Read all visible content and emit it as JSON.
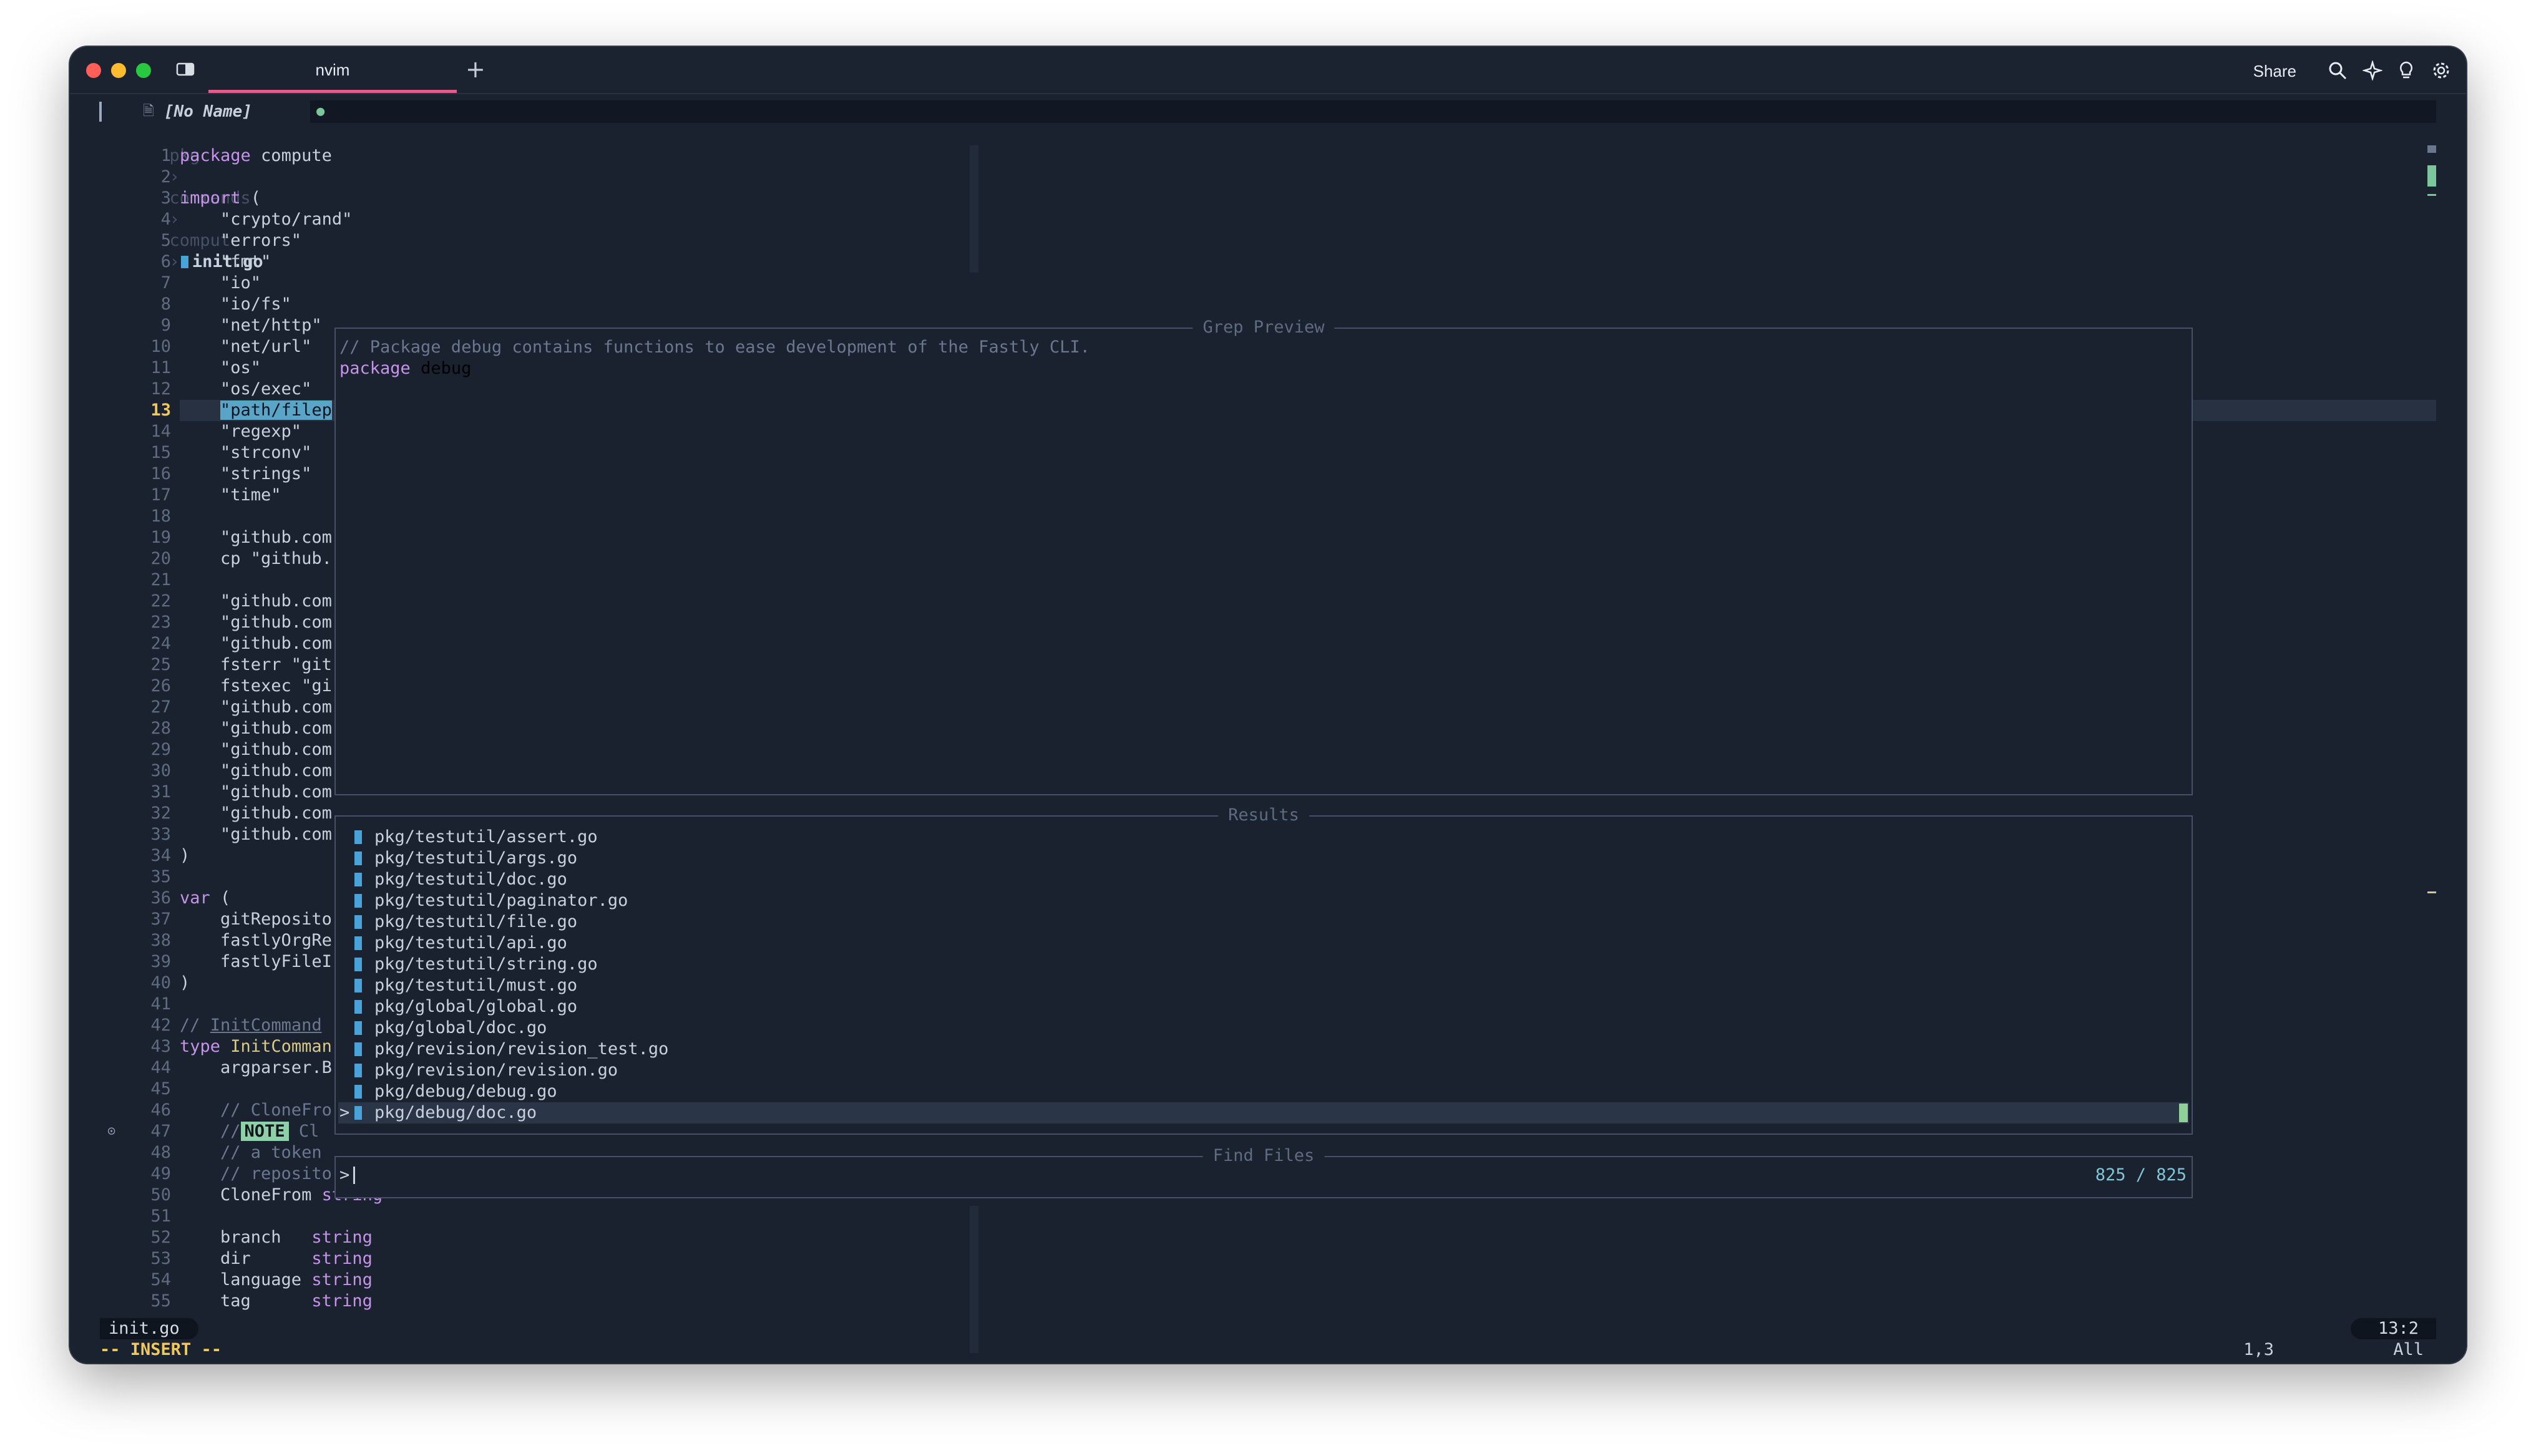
{
  "titlebar": {
    "tab_title": "nvim",
    "new_tab": "+",
    "share_label": "Share"
  },
  "bufferline": {
    "buffer_name": "[No Name]",
    "modified_marker": "●"
  },
  "breadcrumb": {
    "parts": [
      "pkg",
      "commands",
      "compute"
    ],
    "separator": "›",
    "file": "init.go"
  },
  "editor": {
    "current_line": 13,
    "lines": [
      {
        "n": "1",
        "t": "package compute"
      },
      {
        "n": "2",
        "t": ""
      },
      {
        "n": "3",
        "t": "import ("
      },
      {
        "n": "4",
        "t": "    \"crypto/rand\""
      },
      {
        "n": "5",
        "t": "    \"errors\""
      },
      {
        "n": "6",
        "t": "    \"fmt\""
      },
      {
        "n": "7",
        "t": "    \"io\""
      },
      {
        "n": "8",
        "t": "    \"io/fs\""
      },
      {
        "n": "9",
        "t": "    \"net/http\""
      },
      {
        "n": "10",
        "t": "    \"net/url\""
      },
      {
        "n": "11",
        "t": "    \"os\""
      },
      {
        "n": "12",
        "t": "    \"os/exec\""
      },
      {
        "n": "13",
        "t": "\"path/filep"
      },
      {
        "n": "14",
        "t": "    \"regexp\""
      },
      {
        "n": "15",
        "t": "    \"strconv\""
      },
      {
        "n": "16",
        "t": "    \"strings\""
      },
      {
        "n": "17",
        "t": "    \"time\""
      },
      {
        "n": "18",
        "t": ""
      },
      {
        "n": "19",
        "t": "    \"github.com"
      },
      {
        "n": "20",
        "t": "    cp \"github."
      },
      {
        "n": "21",
        "t": ""
      },
      {
        "n": "22",
        "t": "    \"github.com"
      },
      {
        "n": "23",
        "t": "    \"github.com"
      },
      {
        "n": "24",
        "t": "    \"github.com"
      },
      {
        "n": "25",
        "t": "    fsterr \"git"
      },
      {
        "n": "26",
        "t": "    fstexec \"gi"
      },
      {
        "n": "27",
        "t": "    \"github.com"
      },
      {
        "n": "28",
        "t": "    \"github.com"
      },
      {
        "n": "29",
        "t": "    \"github.com"
      },
      {
        "n": "30",
        "t": "    \"github.com"
      },
      {
        "n": "31",
        "t": "    \"github.com"
      },
      {
        "n": "32",
        "t": "    \"github.com"
      },
      {
        "n": "33",
        "t": "    \"github.com"
      },
      {
        "n": "34",
        "t": ")"
      },
      {
        "n": "35",
        "t": ""
      },
      {
        "n": "36",
        "t": "var ("
      },
      {
        "n": "37",
        "t": "    gitReposito"
      },
      {
        "n": "38",
        "t": "    fastlyOrgRe"
      },
      {
        "n": "39",
        "t": "    fastlyFileI"
      },
      {
        "n": "40",
        "t": ")"
      },
      {
        "n": "41",
        "t": ""
      },
      {
        "n": "42",
        "t": "// InitCommand"
      },
      {
        "n": "43",
        "t": "type InitComman"
      },
      {
        "n": "44",
        "t": "    argparser.B"
      },
      {
        "n": "45",
        "t": ""
      },
      {
        "n": "46",
        "t": "    // CloneFro"
      },
      {
        "n": "47",
        "t": "    //"
      },
      {
        "n": "48",
        "t": "    // a token"
      },
      {
        "n": "49",
        "t": "    // repository)."
      },
      {
        "n": "50",
        "t": "    CloneFrom string"
      },
      {
        "n": "51",
        "t": ""
      },
      {
        "n": "52",
        "t": "    branch   string"
      },
      {
        "n": "53",
        "t": "    dir      string"
      },
      {
        "n": "54",
        "t": "    language string"
      },
      {
        "n": "55",
        "t": "    tag      string"
      }
    ],
    "note_badge": "NOTE",
    "note_after": "Cl"
  },
  "grep_preview": {
    "title": "Grep Preview",
    "line1": "// Package debug contains functions to ease development of the Fastly CLI.",
    "line2_kw": "package",
    "line2_name": "debug"
  },
  "results": {
    "title": "Results",
    "items": [
      "pkg/testutil/assert.go",
      "pkg/testutil/args.go",
      "pkg/testutil/doc.go",
      "pkg/testutil/paginator.go",
      "pkg/testutil/file.go",
      "pkg/testutil/api.go",
      "pkg/testutil/string.go",
      "pkg/testutil/must.go",
      "pkg/global/global.go",
      "pkg/global/doc.go",
      "pkg/revision/revision_test.go",
      "pkg/revision/revision.go",
      "pkg/debug/debug.go",
      "pkg/debug/doc.go"
    ],
    "selected_caret": ">"
  },
  "find_files": {
    "title": "Find Files",
    "prompt": ">",
    "count": "825 / 825"
  },
  "statusline": {
    "file": "init.go",
    "position": "13:2"
  },
  "cmdline": {
    "mode": "-- INSERT --",
    "ruler": "1,3",
    "scroll": "All"
  },
  "colors": {
    "background": "#1a2230",
    "accent_tab": "#e55c8a",
    "keyword": "#c792ea",
    "selection": "#5aa4c8",
    "insert_mode": "#f0c95c"
  }
}
